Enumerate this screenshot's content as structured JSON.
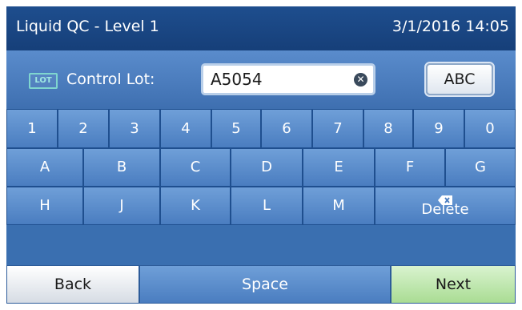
{
  "header": {
    "title": "Liquid QC - Level 1",
    "datetime": "3/1/2016 14:05"
  },
  "lot": {
    "badge": "LOT",
    "label": "Control Lot:",
    "value": "A5054",
    "mode_button": "ABC"
  },
  "keyboard": {
    "row1": [
      "1",
      "2",
      "3",
      "4",
      "5",
      "6",
      "7",
      "8",
      "9",
      "0"
    ],
    "row2": [
      "A",
      "B",
      "C",
      "D",
      "E",
      "F",
      "G"
    ],
    "row3": [
      "H",
      "J",
      "K",
      "L",
      "M"
    ],
    "delete_label": "Delete"
  },
  "footer": {
    "back": "Back",
    "space": "Space",
    "next": "Next"
  },
  "colors": {
    "titlebar": "#1e4e8e",
    "key": "#5a8ccc",
    "next": "#a9dc93",
    "back": "#e8ecf1"
  },
  "icons": {
    "clear": "clear-circle-x-icon",
    "delete": "backspace-icon"
  }
}
